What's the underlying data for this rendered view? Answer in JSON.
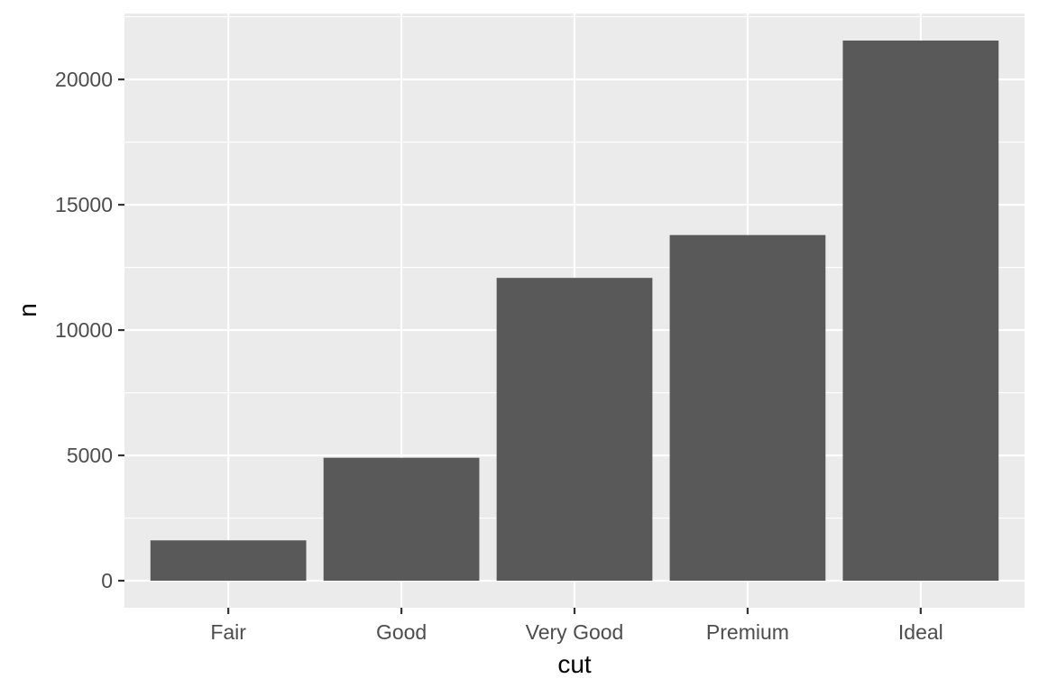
{
  "chart_data": {
    "type": "bar",
    "title": "",
    "xlabel": "cut",
    "ylabel": "n",
    "categories": [
      "Fair",
      "Good",
      "Very Good",
      "Premium",
      "Ideal"
    ],
    "values": [
      1610,
      4906,
      12082,
      13791,
      21551
    ],
    "ylim": [
      -1078,
      22629
    ],
    "yticks": [
      0,
      5000,
      10000,
      15000,
      20000
    ],
    "ytick_labels": [
      "0",
      "5000",
      "10000",
      "15000",
      "20000"
    ],
    "grid": true,
    "legend": "none",
    "colors": {
      "bar": "#595959",
      "panel": "#ebebeb",
      "grid": "#ffffff"
    }
  }
}
